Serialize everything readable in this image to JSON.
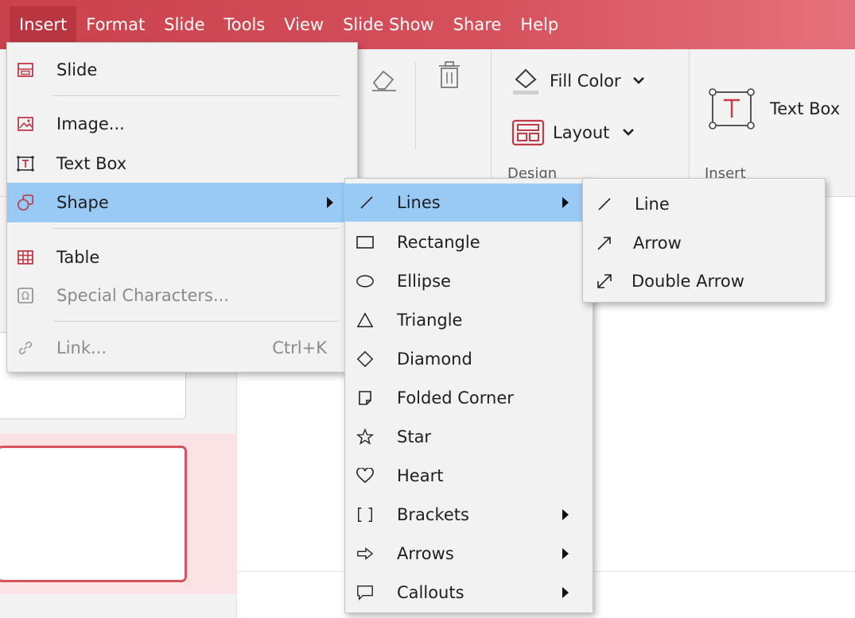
{
  "menubar": {
    "items": [
      "Insert",
      "Format",
      "Slide",
      "Tools",
      "View",
      "Slide Show",
      "Share",
      "Help"
    ],
    "active": "Insert"
  },
  "ribbon": {
    "fill_color_label": "Fill Color",
    "layout_label": "Layout",
    "text_box_label": "Text Box",
    "group_label_design": "Design",
    "group_label_insert": "Insert"
  },
  "insert_menu": {
    "items": [
      {
        "label": "Slide",
        "icon": "slide-icon"
      },
      {
        "label": "Image...",
        "icon": "image-icon"
      },
      {
        "label": "Text Box",
        "icon": "text-box-icon"
      },
      {
        "label": "Shape",
        "icon": "shape-icon",
        "submenu": true,
        "highlighted": true
      },
      {
        "label": "Table",
        "icon": "table-icon"
      },
      {
        "label": "Special Characters...",
        "icon": "special-characters-icon",
        "disabled": true
      },
      {
        "label": "Link...",
        "icon": "link-icon",
        "shortcut": "Ctrl+K",
        "disabled": true
      }
    ]
  },
  "shape_menu": {
    "items": [
      {
        "label": "Lines",
        "icon": "line-icon",
        "submenu": true,
        "highlighted": true
      },
      {
        "label": "Rectangle",
        "icon": "rectangle-icon"
      },
      {
        "label": "Ellipse",
        "icon": "ellipse-icon"
      },
      {
        "label": "Triangle",
        "icon": "triangle-icon"
      },
      {
        "label": "Diamond",
        "icon": "diamond-icon"
      },
      {
        "label": "Folded Corner",
        "icon": "folded-corner-icon"
      },
      {
        "label": "Star",
        "icon": "star-icon"
      },
      {
        "label": "Heart",
        "icon": "heart-icon"
      },
      {
        "label": "Brackets",
        "icon": "brackets-icon",
        "submenu": true
      },
      {
        "label": "Arrows",
        "icon": "arrow-right-icon",
        "submenu": true
      },
      {
        "label": "Callouts",
        "icon": "callout-icon",
        "submenu": true
      }
    ]
  },
  "lines_menu": {
    "items": [
      {
        "label": "Line",
        "icon": "line-icon"
      },
      {
        "label": "Arrow",
        "icon": "arrow-icon"
      },
      {
        "label": "Double Arrow",
        "icon": "double-arrow-icon"
      }
    ]
  },
  "colors": {
    "menubar": "#d04a55",
    "menu_highlight": "#99c9f5",
    "menu_background": "#f2f2f2",
    "accent": "#d4535d"
  }
}
